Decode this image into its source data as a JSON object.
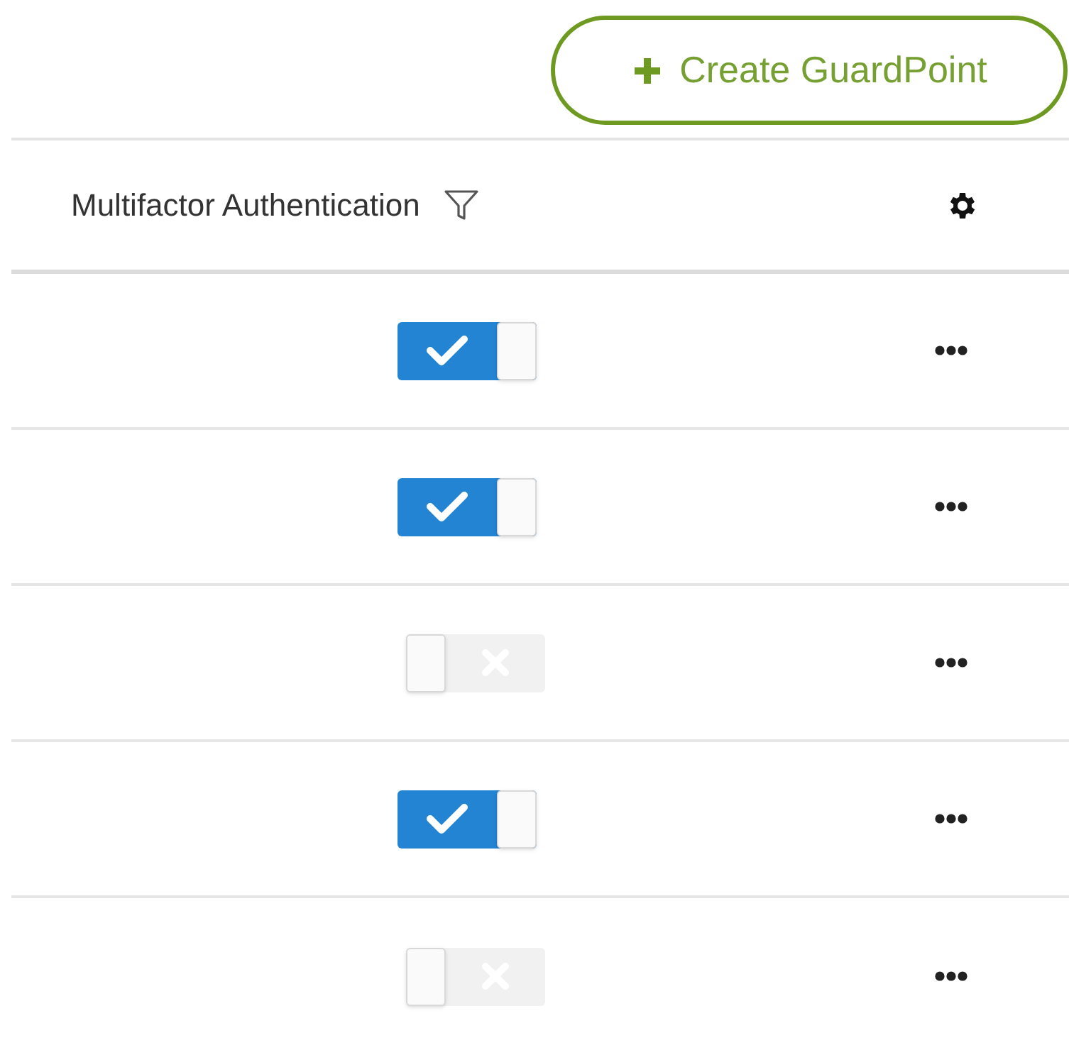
{
  "create_button": {
    "label": "Create GuardPoint"
  },
  "table": {
    "columns": [
      {
        "label": "Multifactor Authentication"
      }
    ],
    "rows": [
      {
        "mfa_on": true
      },
      {
        "mfa_on": true
      },
      {
        "mfa_on": false
      },
      {
        "mfa_on": true
      },
      {
        "mfa_on": false
      }
    ]
  }
}
